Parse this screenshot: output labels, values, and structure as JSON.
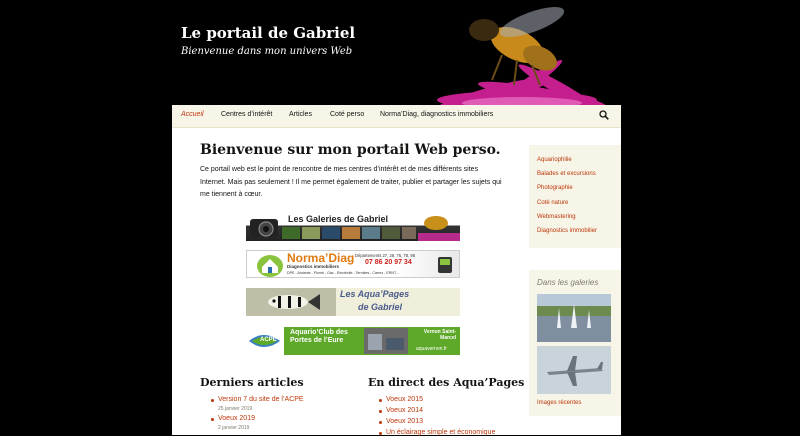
{
  "site": {
    "title": "Le portail de Gabriel",
    "tagline": "Bienvenue dans mon univers Web"
  },
  "nav": {
    "items": [
      {
        "label": "Accueil",
        "active": true
      },
      {
        "label": "Centres d’intérêt",
        "active": false
      },
      {
        "label": "Articles",
        "active": false
      },
      {
        "label": "Coté perso",
        "active": false
      },
      {
        "label": "Norma’Diag, diagnostics immobiliers",
        "active": false
      }
    ],
    "search_icon": "search-icon"
  },
  "main": {
    "title": "Bienvenue sur mon portail Web perso.",
    "intro": "Ce portail web est le point de rencontre de mes centres d’intérêt et de mes différents sites Internet. Mais pas seulement ! Il me permet également de traiter, publier et partager les sujets qui me tiennent à cœur.",
    "banners": {
      "galeries": "Les Galeries de Gabriel",
      "normadiag_name": "Norma’Diag",
      "normadiag_sub": "Diagnostics immobiliers",
      "normadiag_depts": "Départements 27, 28, 76, 78, 95",
      "normadiag_phone": "07 86 20 97 34",
      "normadiag_services": "DPE - Amiante - Plomb - Gaz - Electricité - Termites - Carrez - ERNT...",
      "aquapages_1": "Les Aqua’Pages",
      "aquapages_2": "de Gabriel",
      "acpe_logo": "ACPE",
      "acpe_title": "Aquario’Club des Portes de l’Eure",
      "acpe_city": "Vernon Saint-Marcel",
      "acpe_url": "aquavernon.fr"
    }
  },
  "sidebar": {
    "links": [
      "Aquariophilie",
      "Balades et excursions",
      "Photographie",
      "Coté nature",
      "Webmastering",
      "Diagnostics immobilier"
    ],
    "gallery_title": "Dans les galeries",
    "recent_images": "Images récentes"
  },
  "recent_posts": {
    "title": "Derniers articles",
    "items": [
      {
        "label": "Version 7 du site de l’ACPE",
        "date": "25 janvier 2019"
      },
      {
        "label": "Voeux 2019",
        "date": "2 janvier 2019"
      }
    ]
  },
  "aquapages": {
    "title": "En direct des Aqua’Pages",
    "items": [
      "Voeux 2015",
      "Voeux 2014",
      "Voeux 2013",
      "Un éclairage simple et économique"
    ]
  },
  "colors": {
    "accent": "#bc360a",
    "sidebar_bg": "#f7f5e7",
    "header_bg": "#000000"
  }
}
